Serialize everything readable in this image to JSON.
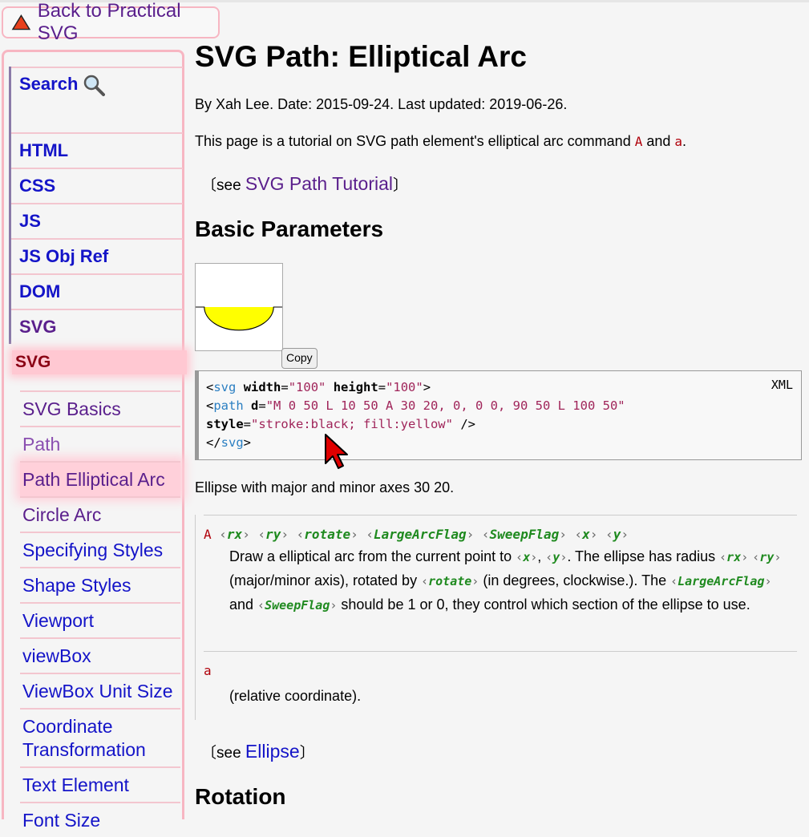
{
  "back": {
    "label": "Back to Practical SVG"
  },
  "topnav": {
    "search": "Search",
    "items": [
      "HTML",
      "CSS",
      "JS",
      "JS Obj Ref",
      "DOM",
      "SVG"
    ]
  },
  "section": {
    "title": "SVG"
  },
  "subnav": [
    "SVG Basics",
    "Path",
    "Path Elliptical Arc",
    "Circle Arc",
    "Specifying Styles",
    "Shape Styles",
    "Viewport",
    "viewBox",
    "ViewBox Unit Size",
    "Coordinate Transformation",
    "Text Element",
    "Font Size"
  ],
  "main": {
    "title": "SVG Path: Elliptical Arc",
    "byline": "By Xah Lee. Date: 2015-09-24. Last updated: 2019-06-26.",
    "intro_pre": "This page is a tutorial on SVG path element's elliptical arc command ",
    "intro_cmd1": "A",
    "intro_and": " and ",
    "intro_cmd2": "a",
    "intro_end": ".",
    "see1_pre": "〔see ",
    "see1_link": "SVG Path Tutorial",
    "see_post": "〕",
    "h2_basic": "Basic Parameters",
    "copy_label": "Copy",
    "code_lang": "XML",
    "caption": "Ellipse with major and minor axes 30 20.",
    "dl": {
      "term_A": "A",
      "params": [
        "rx",
        "ry",
        "rotate",
        "LargeArcFlag",
        "SweepFlag",
        "x",
        "y"
      ],
      "d1": "Draw a elliptical arc from the current point to ",
      "d2": ", ",
      "d3": ". The ellipse has radius ",
      "d4": " (major/minor axis), rotated by ",
      "d5": " (in degrees, clockwise.). The ",
      "d6": " and ",
      "d7": " should be 1 or 0, they control which section of the ellipse to use.",
      "term_a": "a",
      "rel": "(relative coordinate)."
    },
    "see2_pre": "〔see ",
    "see2_link": "Ellipse",
    "h2_rotation": "Rotation"
  }
}
